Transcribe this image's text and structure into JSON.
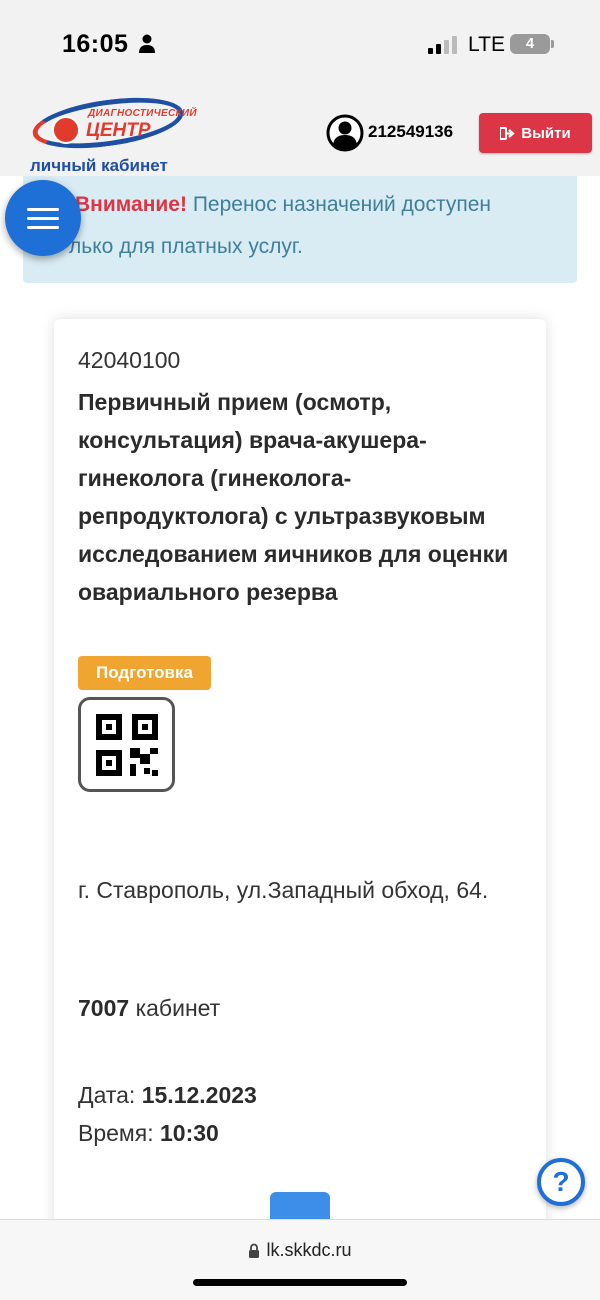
{
  "status_bar": {
    "time": "16:05",
    "network": "LTE",
    "battery": "4"
  },
  "header": {
    "logo_small": "ДИАГНОСТИЧЕСКИЙ",
    "logo_big": "ЦЕНТР",
    "logo_sub": "личный кабинет",
    "user_id": "212549136",
    "logout_label": "Выйти"
  },
  "alert": {
    "strong": "Внимание!",
    "text_line1": "Перенос назначений доступен",
    "text_line2": "лько для платных услуг."
  },
  "appointment": {
    "code": "42040100",
    "name": "Первичный прием (осмотр, консультация) врача-акушера-гинеколога (гинеколога-репродуктолога) с ультразвуковым исследованием яичников для оценки овариального резерва",
    "badge": "Подготовка",
    "address": "г. Ставрополь, ул.Западный обход, 64.",
    "cabinet_number": "7007",
    "cabinet_label": "кабинет",
    "date_label": "Дата:",
    "date": "15.12.2023",
    "time_label": "Время:",
    "time": "10:30"
  },
  "help_label": "?",
  "browser": {
    "url": "lk.skkdc.ru"
  },
  "colors": {
    "danger": "#dc3545",
    "primary": "#1e6fd6",
    "warning": "#f0a531",
    "alert_bg": "#d9ecf4"
  },
  "icons": {
    "menu": "hamburger-icon",
    "user": "user-circle-icon",
    "logout": "sign-out-icon",
    "qr": "qr-code-icon",
    "help": "question-icon",
    "lock": "lock-icon"
  }
}
